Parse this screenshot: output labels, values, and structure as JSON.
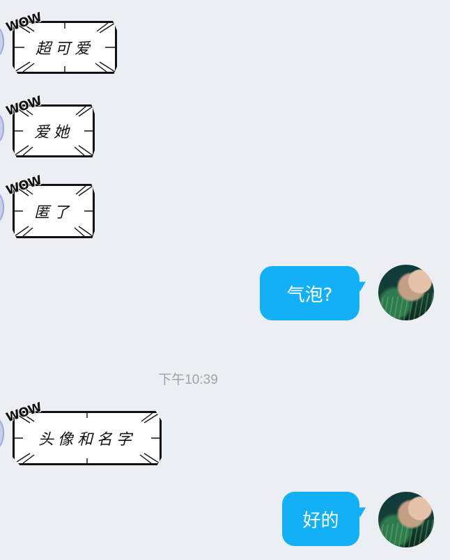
{
  "messages": [
    {
      "side": "left",
      "style": "comic",
      "sticker": "WOW",
      "text": "超可爱"
    },
    {
      "side": "left",
      "style": "comic",
      "sticker": "WOW",
      "text": "爱她"
    },
    {
      "side": "left",
      "style": "comic",
      "sticker": "WOW",
      "text": "匿了"
    },
    {
      "side": "right",
      "style": "bubble",
      "text": "气泡?"
    },
    {
      "side": "left",
      "style": "comic",
      "sticker": "WOW",
      "text": "头像和名字"
    },
    {
      "side": "right",
      "style": "bubble",
      "text": "好的"
    }
  ],
  "timestamp": "下午10:39",
  "colors": {
    "background": "#ebeef2",
    "outgoing_bubble": "#14b0f5",
    "outgoing_text": "#ffffff",
    "timestamp": "#9ea3ab"
  },
  "icons": {
    "left_avatar": "user-avatar-icon",
    "right_avatar": "self-avatar-photo"
  }
}
